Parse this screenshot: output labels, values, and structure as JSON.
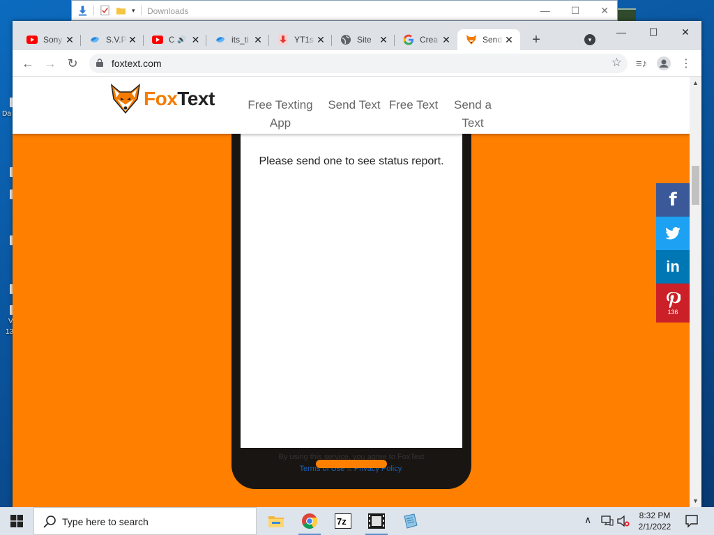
{
  "explorer": {
    "title": "Downloads",
    "minimize": "—",
    "maximize": "☐",
    "close": "✕"
  },
  "desktop": {
    "labels": [
      "Da",
      "V",
      "13"
    ]
  },
  "tabs": [
    {
      "label": "Sony",
      "favicon": "youtube-icon"
    },
    {
      "label": "S.V.P",
      "favicon": "svp-icon"
    },
    {
      "label": "C",
      "favicon": "youtube-icon",
      "audio": "🔊"
    },
    {
      "label": "its_ti",
      "favicon": "svp-icon"
    },
    {
      "label": "YT1s",
      "favicon": "download-icon"
    },
    {
      "label": "Site",
      "favicon": "globe-icon"
    },
    {
      "label": "Crea",
      "favicon": "google-icon"
    },
    {
      "label": "Send",
      "favicon": "foxtext-icon",
      "active": true
    }
  ],
  "chrome": {
    "url": "foxtext.com",
    "new_tab": "+",
    "minimize": "—",
    "maximize": "☐",
    "close": "✕",
    "tab_close": "✕"
  },
  "site": {
    "logo_fox": "Fox",
    "logo_text": "Text",
    "nav": [
      "Free Texting App",
      "Send Text",
      "Free Text",
      "Send a Text"
    ],
    "status_message": "Please send one to see status report.",
    "terms_prefix": "By using this service, you agree to FoxText",
    "terms_link": "Terms of Use",
    "terms_amp": "&",
    "privacy_link": "Privacy Policy",
    "terms_end": "."
  },
  "share": [
    {
      "network": "facebook",
      "glyph": "f",
      "color": "#3b5998"
    },
    {
      "network": "twitter",
      "glyph": "🐦",
      "color": "#1da1f2"
    },
    {
      "network": "linkedin",
      "glyph": "in",
      "color": "#0077b5"
    },
    {
      "network": "pinterest",
      "glyph": "P",
      "color": "#cb2027",
      "count": "136"
    }
  ],
  "taskbar": {
    "search_placeholder": "Type here to search",
    "time": "8:32 PM",
    "date": "2/1/2022",
    "apps": [
      "file-explorer-icon",
      "chrome-icon",
      "7zip-icon",
      "video-editor-icon",
      "notepad-icon"
    ]
  }
}
